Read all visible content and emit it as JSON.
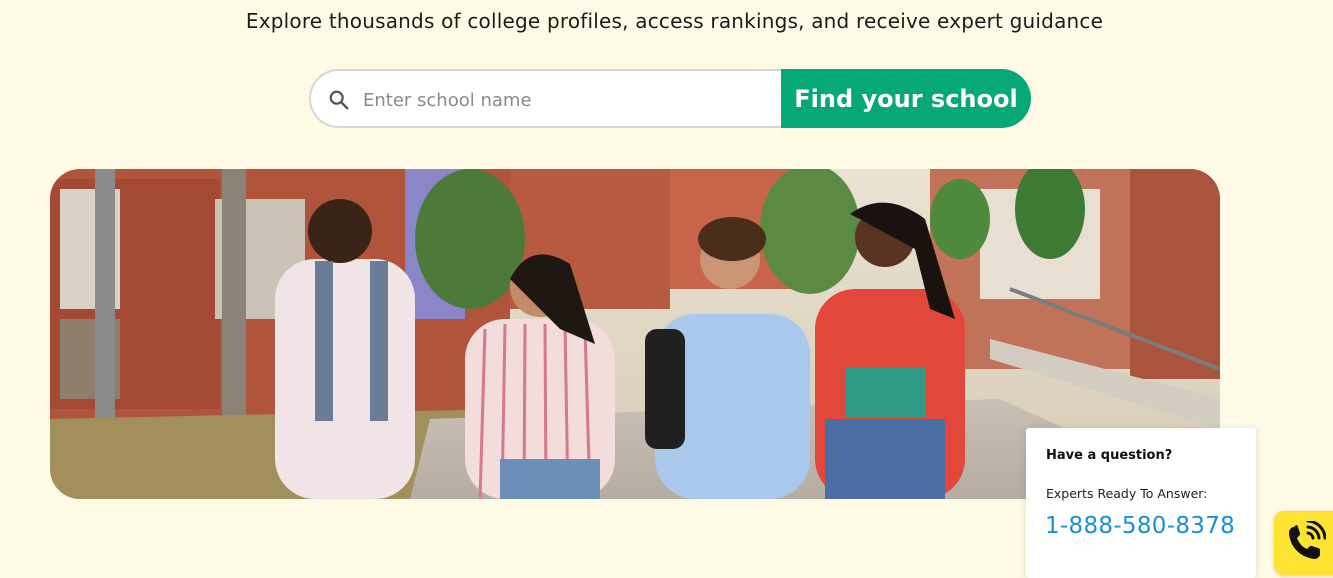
{
  "hero": {
    "subtitle": "Explore thousands of college profiles, access rankings, and receive expert guidance"
  },
  "search": {
    "placeholder": "Enter school name",
    "value": "",
    "button_label": "Find your school",
    "icon": "search-icon"
  },
  "photo": {
    "description_icon": "students-walking-photo"
  },
  "help_widget": {
    "title": "Have a question?",
    "subtitle": "Experts Ready To Answer:",
    "phone": "1-888-580-8378"
  },
  "call_button": {
    "icon": "phone-call-icon"
  },
  "colors": {
    "background": "#fefae6",
    "accent_green": "#07a877",
    "phone_blue": "#1a8fd6",
    "call_yellow": "#ffe333"
  }
}
